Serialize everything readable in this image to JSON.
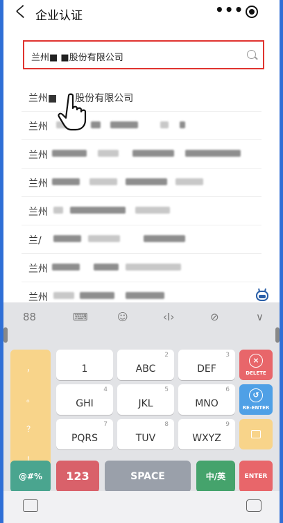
{
  "header": {
    "title": "企业认证",
    "back_glyph": "く",
    "more_glyph": "•••"
  },
  "search": {
    "value": "兰州■ ■股份有限公司",
    "icon": "search-icon"
  },
  "results": [
    {
      "label": "兰州■",
      "suffix": "股份有限公司"
    },
    {
      "label": "兰州"
    },
    {
      "label": "兰州"
    },
    {
      "label": "兰州"
    },
    {
      "label": "兰州"
    },
    {
      "label": "兰/"
    },
    {
      "label": "兰州"
    },
    {
      "label": "兰州"
    }
  ],
  "keyboard": {
    "toolbar": [
      "88",
      "⌨",
      "☺",
      "‹I›",
      "⊘",
      "∨"
    ],
    "punct": [
      "，",
      "。",
      "？",
      "！"
    ],
    "keys": [
      {
        "main": "1",
        "sub": ""
      },
      {
        "main": "ABC",
        "sub": "2"
      },
      {
        "main": "DEF",
        "sub": "3"
      },
      {
        "main": "GHI",
        "sub": "4"
      },
      {
        "main": "JKL",
        "sub": "5"
      },
      {
        "main": "MNO",
        "sub": "6"
      },
      {
        "main": "PQRS",
        "sub": "7"
      },
      {
        "main": "TUV",
        "sub": "8"
      },
      {
        "main": "WXYZ",
        "sub": "9"
      }
    ],
    "delete_label": "DELETE",
    "reenter_label": "RE-ENTER",
    "symbols_label": "@#%",
    "num_label": "123",
    "space_label": "SPACE",
    "lang_label": "中/英",
    "enter_label": "ENTER"
  },
  "colors": {
    "search_border": "#e0332f",
    "delete": "#e8666a",
    "reenter": "#4fa0e6",
    "punct": "#f8d48a",
    "symbols": "#4aa58f",
    "num": "#d9616a",
    "space": "#9aa0aa",
    "lang": "#45a36c",
    "enter": "#e8666a"
  }
}
